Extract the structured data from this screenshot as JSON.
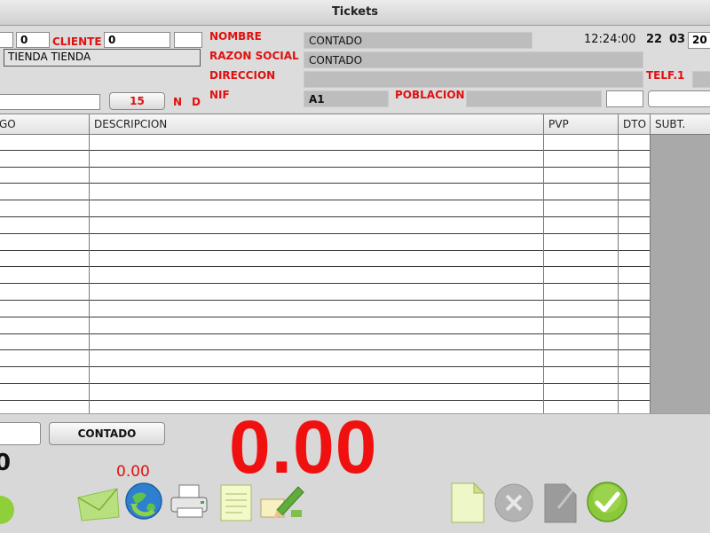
{
  "window": {
    "title": "Tickets"
  },
  "header": {
    "field_a": "0",
    "cliente_label": "CLIENTE",
    "cliente_value": "0",
    "tienda_value": "TIENDA TIENDA",
    "number_button": "15",
    "n_label": "N",
    "d_label": "D",
    "nombre_label": "NOMBRE",
    "nombre_value": "CONTADO",
    "razon_label": "RAZON SOCIAL",
    "razon_value": "CONTADO",
    "direccion_label": "DIRECCION",
    "nif_label": "NIF",
    "nif_value": "A1",
    "poblacion_label": "POBLACION",
    "telf_label": "TELF.1",
    "time": "12:24:00",
    "day": "22",
    "month": "03",
    "year_partial": "20"
  },
  "grid": {
    "columns": [
      "GO",
      "DESCRIPCION",
      "PVP",
      "DTO",
      "SUBT."
    ],
    "rows": 16
  },
  "footer": {
    "contado_button": "CONTADO",
    "small_total": "0.00",
    "left_value": "0",
    "big_total": "0.00"
  },
  "colors": {
    "accent_red": "#e01010",
    "total_red": "#f01010"
  }
}
